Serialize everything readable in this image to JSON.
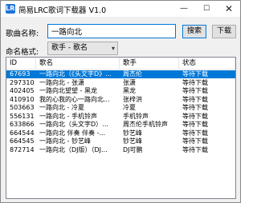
{
  "window": {
    "title": "简易LRC歌词下载器 V1.0",
    "icon_text": "LRC",
    "controls": {
      "minimize": "—",
      "maximize": "☐",
      "close": "✕"
    }
  },
  "form": {
    "song_label": "歌曲名称:",
    "song_value": "一路向北",
    "format_label": "命名格式:",
    "format_value": "歌手 - 歌名",
    "search_button": "搜索",
    "download_button": "下载"
  },
  "table": {
    "headers": [
      "ID",
      "歌名",
      "歌手",
      "状态"
    ],
    "rows": [
      {
        "id": "67693",
        "name": "一路向北（《头文字D》...",
        "singer": "周杰伦",
        "status": "等待下载",
        "selected": true
      },
      {
        "id": "297310",
        "name": "一路向北 - 张潇",
        "singer": "张潇",
        "status": "等待下载",
        "selected": false
      },
      {
        "id": "402405",
        "name": "一路向北望望 - 黑龙",
        "singer": "黑龙",
        "status": "等待下载",
        "selected": false
      },
      {
        "id": "410910",
        "name": "我的心我的心一路向北...",
        "singer": "张梓洪",
        "status": "等待下载",
        "selected": false
      },
      {
        "id": "503663",
        "name": "一路向北 - 冷夏",
        "singer": "冷夏",
        "status": "等待下载",
        "selected": false
      },
      {
        "id": "556131",
        "name": "一路向北 - 手机铃声",
        "singer": "手机铃声",
        "status": "等待下载",
        "selected": false
      },
      {
        "id": "633866",
        "name": "一路向北（头文字D）...",
        "singer": "周杰伦手机铃声",
        "status": "等待下载",
        "selected": false
      },
      {
        "id": "664544",
        "name": "一路向北 伴奏 伴奏 -...",
        "singer": "钞艺峰",
        "status": "等待下载",
        "selected": false
      },
      {
        "id": "664545",
        "name": "一路向北 - 钞艺峰",
        "singer": "钞艺峰",
        "status": "等待下载",
        "selected": false
      },
      {
        "id": "872714",
        "name": "一路向北（DJ版）（DJ...",
        "singer": "DJ可鹏",
        "status": "等待下载",
        "selected": false
      }
    ]
  },
  "colors": {
    "selection": "#0078d7",
    "window_bg": "#f0f0f0"
  }
}
